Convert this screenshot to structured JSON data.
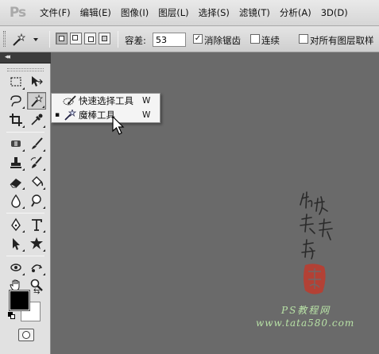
{
  "app": {
    "logo": "Ps"
  },
  "menu": {
    "items": [
      "文件(F)",
      "编辑(E)",
      "图像(I)",
      "图层(L)",
      "选择(S)",
      "滤镜(T)",
      "分析(A)",
      "3D(D)"
    ]
  },
  "options": {
    "tolerance_label": "容差:",
    "tolerance_value": "53",
    "antialias_label": "消除锯齿",
    "antialias_checked": "✓",
    "contiguous_label": "连续",
    "sample_all_label": "对所有图层取样"
  },
  "tools": {
    "panel_collapse": "◂◂",
    "selected_tool": "magic-wand"
  },
  "flyout": {
    "items": [
      {
        "label": "快速选择工具",
        "shortcut": "W",
        "active": ""
      },
      {
        "label": "魔棒工具",
        "shortcut": "W",
        "active": "▪"
      }
    ]
  },
  "colors": {
    "foreground": "#000000",
    "background": "#ffffff",
    "canvas": "#6a6a6a",
    "watermark_green": "#b8e2a6",
    "seal_red": "#c0392b"
  },
  "watermark": {
    "site_name": "PS教程网",
    "site_url": "www.tata580.com"
  }
}
